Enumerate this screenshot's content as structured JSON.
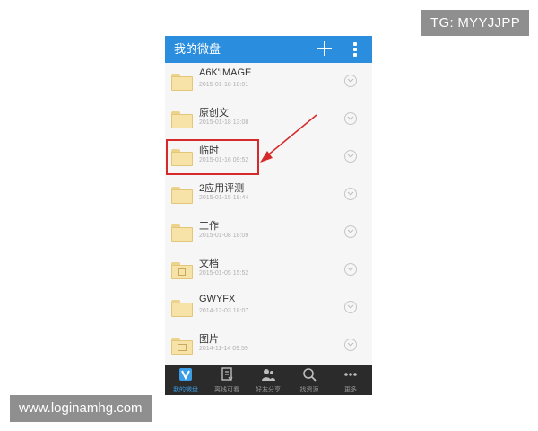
{
  "watermarks": {
    "top": "TG: MYYJJPP",
    "bottom": "www.loginamhg.com"
  },
  "header": {
    "title": "我的微盘",
    "add_icon": "plus-icon",
    "menu_icon": "more-vertical-icon"
  },
  "files": [
    {
      "name": "A6K'IMAGE",
      "date": "2015-01-18 18:01",
      "icon": "folder-icon"
    },
    {
      "name": "原创文",
      "date": "2015-01-18 13:08",
      "icon": "folder-icon"
    },
    {
      "name": "临时",
      "date": "2015-01-16 09:52",
      "icon": "folder-icon"
    },
    {
      "name": "2应用评测",
      "date": "2015-01-15 18:44",
      "icon": "folder-icon"
    },
    {
      "name": "工作",
      "date": "2015-01-08 18:09",
      "icon": "folder-icon"
    },
    {
      "name": "文档",
      "date": "2015-01-05 15:52",
      "icon": "document-folder-icon"
    },
    {
      "name": "GWYFX",
      "date": "2014-12-03 18:07",
      "icon": "folder-icon"
    },
    {
      "name": "图片",
      "date": "2014-11-14 09:59",
      "icon": "image-folder-icon"
    }
  ],
  "tabs": [
    {
      "label": "我的微盘",
      "icon": "vdisk-icon",
      "active": true
    },
    {
      "label": "离线可看",
      "icon": "offline-download-icon",
      "active": false
    },
    {
      "label": "好友分享",
      "icon": "friends-share-icon",
      "active": false
    },
    {
      "label": "找资源",
      "icon": "search-icon",
      "active": false
    },
    {
      "label": "更多",
      "icon": "more-dots-icon",
      "active": false
    }
  ],
  "colors": {
    "header": "#2a8dde",
    "tabbar": "#2b2b2b",
    "active_tab": "#3a9de6",
    "highlight": "#d62a2a"
  }
}
